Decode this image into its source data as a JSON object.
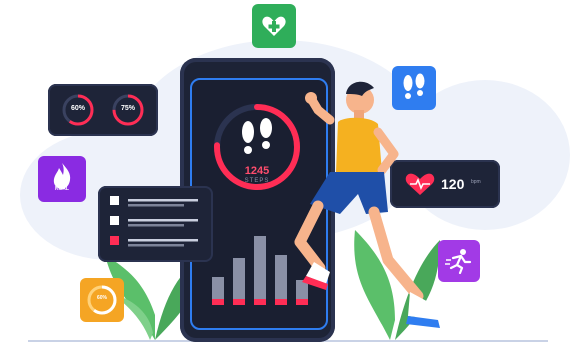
{
  "gauges": [
    {
      "label": "60%",
      "fraction": 0.6
    },
    {
      "label": "75%",
      "fraction": 0.75
    }
  ],
  "steps": {
    "count": "1245",
    "label": "STEPS"
  },
  "heart_rate": {
    "value": "120",
    "unit": "bpm"
  },
  "calories": {
    "label": "KCAL"
  },
  "progress_ring": {
    "label": "60%",
    "fraction": 0.6
  },
  "checklist": {
    "items": 3,
    "checked": [
      false,
      false,
      true
    ]
  },
  "bars": [
    0.3,
    0.55,
    0.85,
    0.6,
    0.25
  ],
  "icons": [
    "heart-plus-icon",
    "footprints-icon",
    "flame-icon",
    "running-person-icon",
    "heartbeat-icon"
  ],
  "colors": {
    "accent": "#ff2d55",
    "dark": "#1e2438",
    "blue": "#2f7df0",
    "green": "#2fae5a",
    "purple": "#8a2be2",
    "orange": "#f5a524",
    "leaf": "#5bbf6a"
  }
}
